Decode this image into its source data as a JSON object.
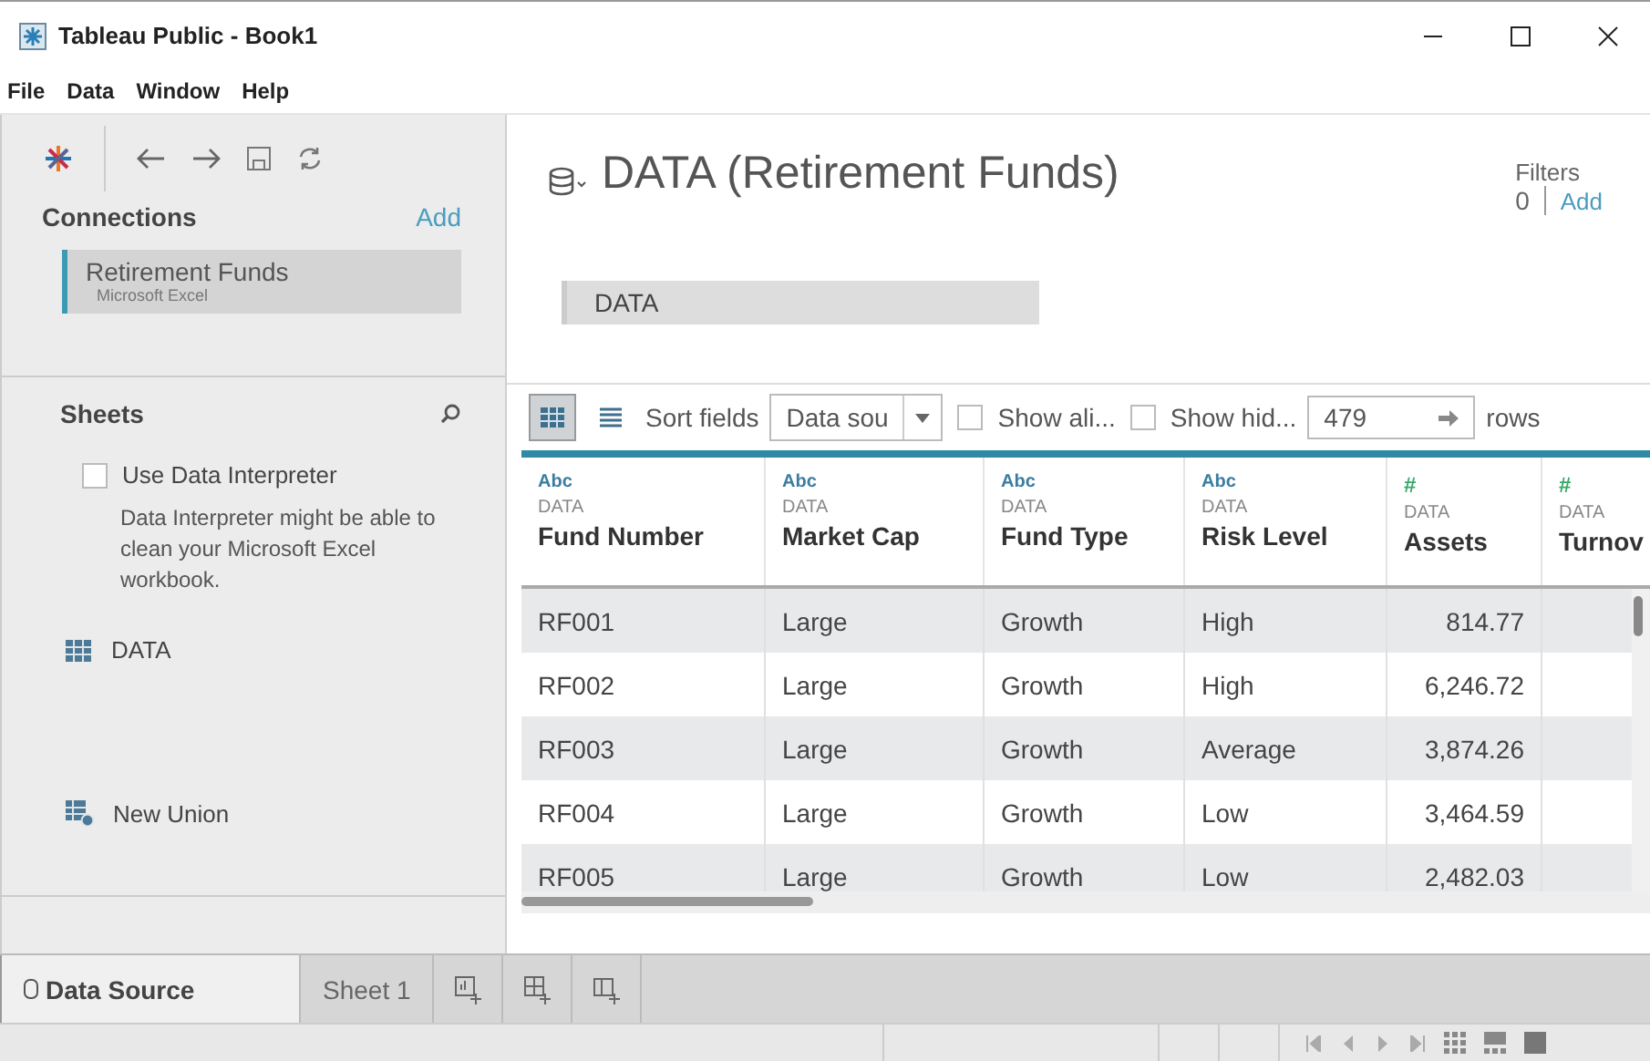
{
  "window": {
    "title": "Tableau Public - Book1"
  },
  "menu": [
    "File",
    "Data",
    "Window",
    "Help"
  ],
  "connections": {
    "heading": "Connections",
    "add": "Add",
    "items": [
      {
        "name": "Retirement Funds",
        "type": "Microsoft Excel",
        "selected": true
      }
    ]
  },
  "sheets": {
    "heading": "Sheets",
    "interpreter": {
      "label": "Use Data Interpreter",
      "checked": false
    },
    "hint": "Data Interpreter might be able to clean your Microsoft Excel workbook.",
    "items": [
      {
        "name": "DATA",
        "kind": "table"
      },
      {
        "name": "New Union",
        "kind": "union"
      }
    ]
  },
  "datasource": {
    "title": "DATA (Retirement Funds)",
    "filters": {
      "label": "Filters",
      "count": "0",
      "add": "Add"
    },
    "canvas_table": "DATA"
  },
  "grid_toolbar": {
    "views": [
      {
        "kind": "grid",
        "selected": true
      },
      {
        "kind": "list",
        "selected": false
      }
    ],
    "sort_label": "Sort fields",
    "sort_value": "Data sou",
    "show_aliases": {
      "label": "Show ali...",
      "checked": false
    },
    "show_hidden": {
      "label": "Show hid...",
      "checked": false
    },
    "rows_value": "479",
    "rows_label": "rows"
  },
  "table": {
    "columns": [
      {
        "type_label": "Abc",
        "kind": "string",
        "source": "DATA",
        "name": "Fund Number"
      },
      {
        "type_label": "Abc",
        "kind": "string",
        "source": "DATA",
        "name": "Market Cap"
      },
      {
        "type_label": "Abc",
        "kind": "string",
        "source": "DATA",
        "name": "Fund Type"
      },
      {
        "type_label": "Abc",
        "kind": "string",
        "source": "DATA",
        "name": "Risk Level"
      },
      {
        "type_label": "#",
        "kind": "number",
        "source": "DATA",
        "name": "Assets"
      },
      {
        "type_label": "#",
        "kind": "number",
        "source": "DATA",
        "name": "Turnov"
      }
    ],
    "rows": [
      [
        "RF001",
        "Large",
        "Growth",
        "High",
        "814.77"
      ],
      [
        "RF002",
        "Large",
        "Growth",
        "High",
        "6,246.72"
      ],
      [
        "RF003",
        "Large",
        "Growth",
        "Average",
        "3,874.26"
      ],
      [
        "RF004",
        "Large",
        "Growth",
        "Low",
        "3,464.59"
      ],
      [
        "RF005",
        "Large",
        "Growth",
        "Low",
        "2,482.03"
      ]
    ]
  },
  "bottom_tabs": [
    {
      "label": "Data Source",
      "kind": "datasource",
      "selected": true
    },
    {
      "label": "Sheet 1",
      "kind": "sheet",
      "selected": false
    }
  ]
}
